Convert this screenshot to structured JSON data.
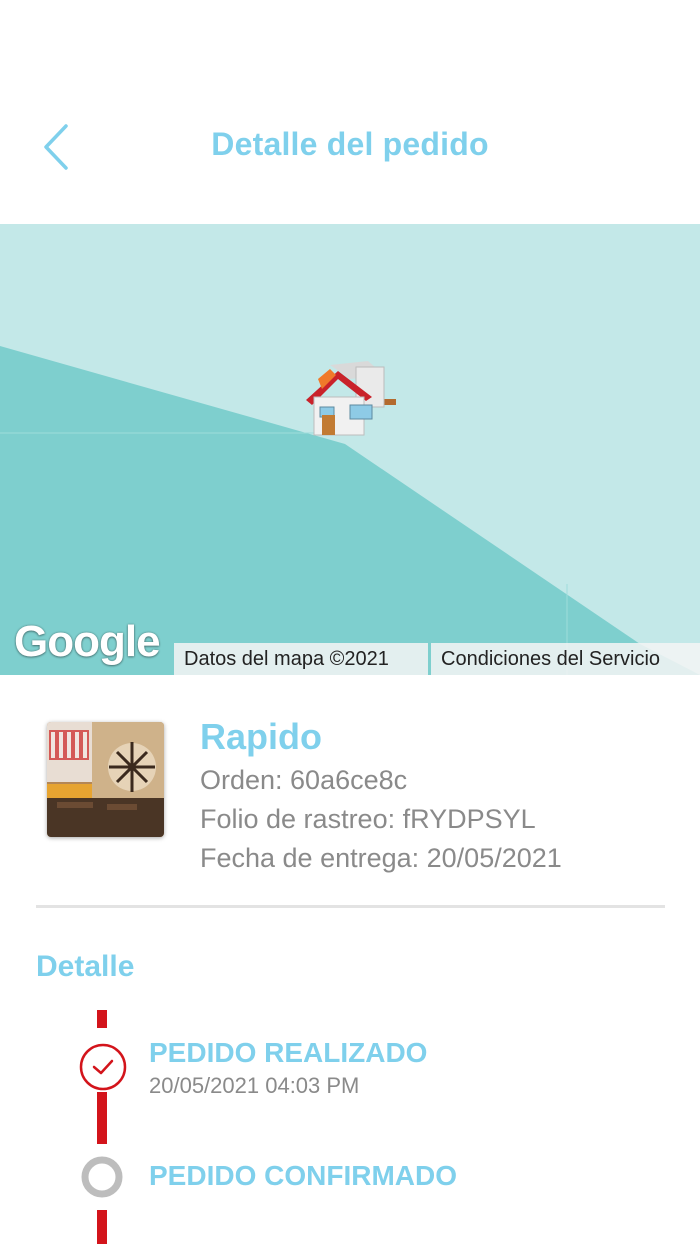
{
  "header": {
    "title": "Detalle del pedido"
  },
  "map": {
    "logo_text": "Google",
    "map_data_label": "Datos del mapa ©2021",
    "terms_label": "Condiciones del Servicio"
  },
  "store": {
    "name": "Rapido",
    "order": "Orden: 60a6ce8c",
    "tracking": "Folio de rastreo: fRYDPSYL",
    "delivery_date": "Fecha de entrega: 20/05/2021"
  },
  "detail": {
    "section_title": "Detalle",
    "steps": [
      {
        "title": "PEDIDO REALIZADO",
        "time": "20/05/2021 04:03 PM",
        "status": "done"
      },
      {
        "title": "PEDIDO CONFIRMADO",
        "time": "",
        "status": "pending"
      }
    ]
  },
  "colors": {
    "accent": "#7fd0ec",
    "timeline": "#d3141b",
    "map_light": "#c3e8e8",
    "map_dark": "#7ecfce",
    "pending": "#bdbdbd"
  }
}
